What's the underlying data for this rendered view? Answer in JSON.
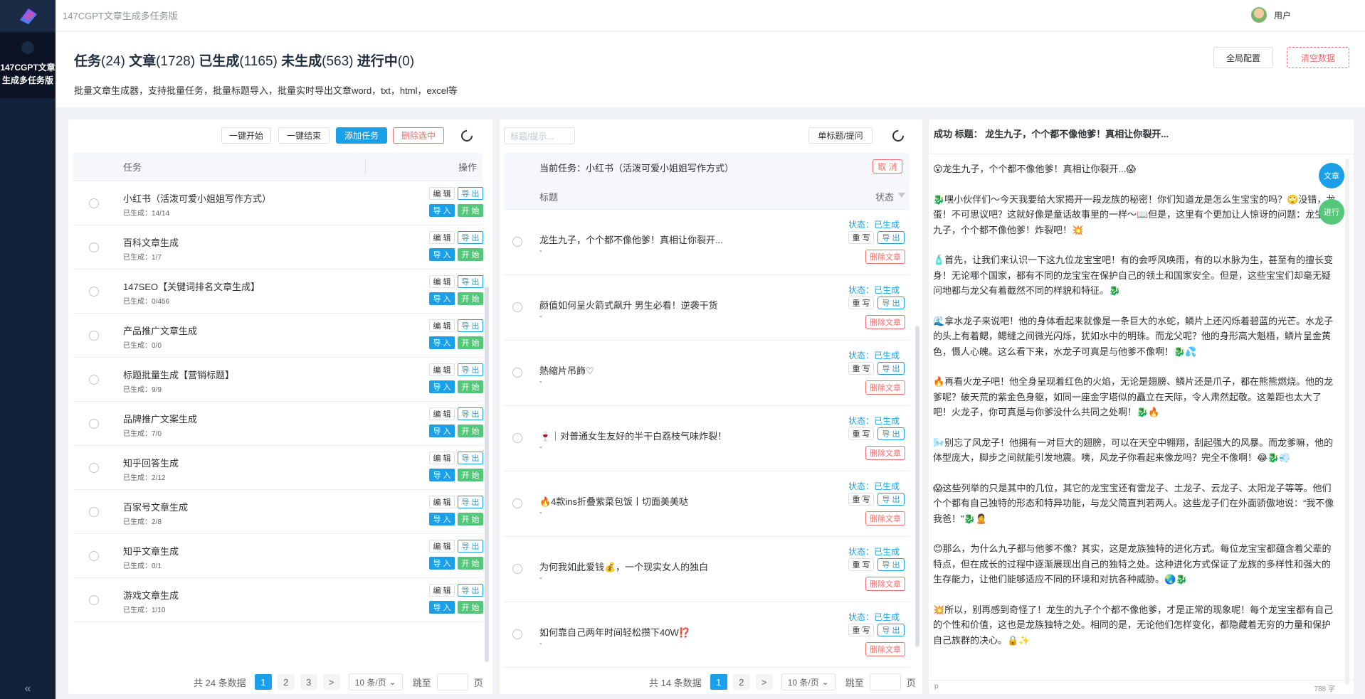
{
  "app": {
    "title": "147CGPT文章生成多任务版",
    "sidebar_label": "147CGPT文章生成多任务版",
    "collapse_icon": "«",
    "user": "用户"
  },
  "header": {
    "stats": {
      "tasks_label": "任务",
      "tasks": "(24)",
      "articles_label": "文章",
      "articles": "(1728)",
      "generated_label": "已生成",
      "generated": "(1165)",
      "ungenerated_label": "未生成",
      "ungenerated": "(563)",
      "running_label": "进行中",
      "running": "(0)"
    },
    "description": "批量文章生成器，支持批量任务，批量标题导入，批量实时导出文章word，txt，html，excel等",
    "global_config": "全局配置",
    "clear_data": "清空数据"
  },
  "tasks_panel": {
    "start_all": "一键开始",
    "stop_all": "一键结束",
    "add_task": "添加任务",
    "delete_selected": "删除选中",
    "col_task": "任务",
    "col_action": "操作",
    "edit_label": "编 辑",
    "export_label": "导 出",
    "import_label": "导 入",
    "start_label": "开 始",
    "generated_prefix": "已生成：",
    "rows": [
      {
        "name": "小红书（活泼可爱小姐姐写作方式）",
        "progress": "14/14"
      },
      {
        "name": "百科文章生成",
        "progress": "1/7"
      },
      {
        "name": "147SEO【关键词排名文章生成】",
        "progress": "0/456"
      },
      {
        "name": "产品推广文章生成",
        "progress": "0/0"
      },
      {
        "name": "标题批量生成【营销标题】",
        "progress": "9/9"
      },
      {
        "name": "品牌推广文案生成",
        "progress": "7/0"
      },
      {
        "name": "知乎回答生成",
        "progress": "2/12"
      },
      {
        "name": "百家号文章生成",
        "progress": "2/8"
      },
      {
        "name": "知乎文章生成",
        "progress": "0/1"
      },
      {
        "name": "游戏文章生成",
        "progress": "1/10"
      }
    ],
    "pager": {
      "total": "共 24 条数据",
      "pages": [
        "1",
        "2",
        "3"
      ],
      "active": "1",
      "next": ">",
      "page_size": "10 条/页",
      "jump_label": "跳至",
      "page_unit": "页"
    }
  },
  "articles_panel": {
    "search_placeholder": "标题/提示...",
    "single_title": "单标题/提问",
    "current_task": "当前任务：小红书（活泼可爱小姐姐写作方式）",
    "cancel": "取 消",
    "col_title": "标题",
    "col_status": "状态",
    "status_text": "状态：已生成",
    "rewrite": "重 写",
    "export": "导 出",
    "delete": "删除文章",
    "dash": "-",
    "rows": [
      {
        "title": "龙生九子，个个都不像他爹！真相让你裂开..."
      },
      {
        "title": "颜值如何呈火箭式飙升 男生必看！逆袭干货"
      },
      {
        "title": "熱縮片吊飾♡"
      },
      {
        "title": "🍷｜对普通女生友好的半干白荔枝气味炸裂！"
      },
      {
        "title": "🔥4款ins折叠紫菜包饭丨切面美美哒"
      },
      {
        "title": "为何我如此爱钱💰，一个现实女人的独白"
      },
      {
        "title": "如何靠自己两年时间轻松攒下40W⁉️"
      }
    ],
    "pager": {
      "total": "共 14 条数据",
      "pages": [
        "1",
        "2"
      ],
      "active": "1",
      "next": ">",
      "page_size": "10 条/页",
      "jump_label": "跳至",
      "page_unit": "页"
    }
  },
  "preview_panel": {
    "title": "成功 标题： 龙生九子，个个都不像他爹！真相让你裂开...",
    "fab_article": "文章",
    "fab_running": "进行",
    "paragraphs": [
      "😮龙生九子，个个都不像他爹！真相让你裂开...😱",
      "🐉嘿小伙伴们～今天我要给大家揭开一段龙族的秘密！你们知道龙是怎么生宝宝的吗？🙄没错，龙蛋！不可思议吧？这就好像是童话故事里的一样～📖但是，这里有个更加让人惊讶的问题：龙生的九子，个个都不像他爹！炸裂吧！💥",
      "🧴首先，让我们来认识一下这九位龙宝宝吧！有的会呼风唤雨，有的以水脉为生，甚至有的擅长变身！无论哪个国家，都有不同的龙宝宝在保护自己的领土和国家安全。但是，这些宝宝们却毫无疑问地都与龙父有着截然不同的样貌和特征。🐉",
      "🌊拿水龙子来说吧！他的身体看起来就像是一条巨大的水蛇，鳞片上还闪烁着碧蓝的光芒。水龙子的头上有着鳃，鳃缝之间微光闪烁，犹如水中的明珠。而龙父呢？他的身形高大魁梧，鳞片呈金黄色，慑人心魄。这么看下来，水龙子可真是与他爹不像啊！🐉💦",
      "🔥再看火龙子吧！他全身呈现着红色的火焰，无论是翅膀、鳞片还是爪子，都在熊熊燃烧。他的龙爹呢？破天荒的紫金色身躯，如同一座金字塔似的矗立在天际，令人肃然起敬。这差距也太大了吧！火龙子，你可真是与你爹没什么共同之处啊！🐉🔥",
      "🌬️别忘了风龙子！他拥有一对巨大的翅膀，可以在天空中翱翔，刮起强大的风暴。而龙爹嘛，他的体型庞大，脚步之间就能引发地震。咦，风龙子你看起来像龙吗？完全不像啊！😂🐉💨",
      "😱这些列举的只是其中的几位，其它的龙宝宝还有雷龙子、土龙子、云龙子、太阳龙子等等。他们个个都有自己独特的形态和特异功能，与龙父简直判若两人。这些龙子们在外面骄傲地说：“我不像我爸！”🐉🙎",
      "😊那么，为什么九子都与他爹不像？其实，这是龙族独特的进化方式。每位龙宝宝都蕴含着父辈的特点，但在成长的过程中逐渐展现出自己的独特之处。这种进化方式保证了龙族的多样性和强大的生存能力，让他们能够适应不同的环境和对抗各种威胁。🌏🐉",
      "💥所以，别再感到奇怪了！龙生的九子个个都不像他爹，才是正常的现象呢！每个龙宝宝都有自己的个性和价值，这也是龙族独特之处。相同的是，无论他们怎样变化，都隐藏着无穷的力量和保护自己族群的决心。🔒✨"
    ],
    "footer_tag": "p",
    "word_count": "788 字"
  }
}
